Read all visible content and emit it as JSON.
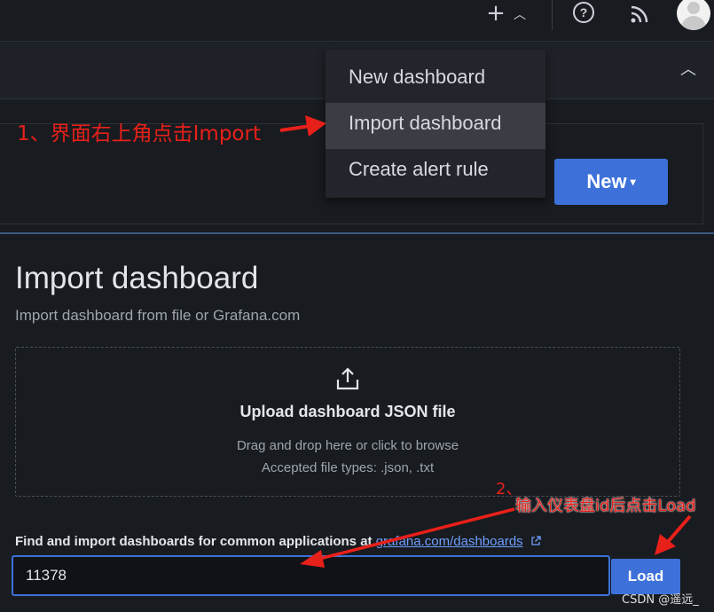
{
  "topbar": {
    "icons": [
      "plus-icon",
      "chevron-up-icon",
      "help-icon",
      "rss-icon",
      "avatar"
    ]
  },
  "menu": {
    "items": [
      {
        "label": "New dashboard"
      },
      {
        "label": "Import dashboard"
      },
      {
        "label": "Create alert rule"
      }
    ]
  },
  "new_button": {
    "label": "New",
    "icon": "chevron-down-icon"
  },
  "annotations": {
    "step1": "1、界面右上角点击Import",
    "step2_num": "2、",
    "step2_text": "输入仪表盘id后点击Load",
    "color": "#e8201a"
  },
  "main": {
    "title": "Import dashboard",
    "subtitle": "Import dashboard from file or Grafana.com",
    "upload": {
      "title": "Upload dashboard JSON file",
      "hint": "Drag and drop here or click to browse",
      "types": "Accepted file types: .json, .txt"
    },
    "find_label": "Find and import dashboards for common applications at",
    "find_link": "grafana.com/dashboards",
    "id_value": "11378",
    "load_label": "Load"
  },
  "watermark": "CSDN @遥远_",
  "colors": {
    "accent": "#3d71d9",
    "background": "#181b1f",
    "link": "#6e9fff"
  }
}
